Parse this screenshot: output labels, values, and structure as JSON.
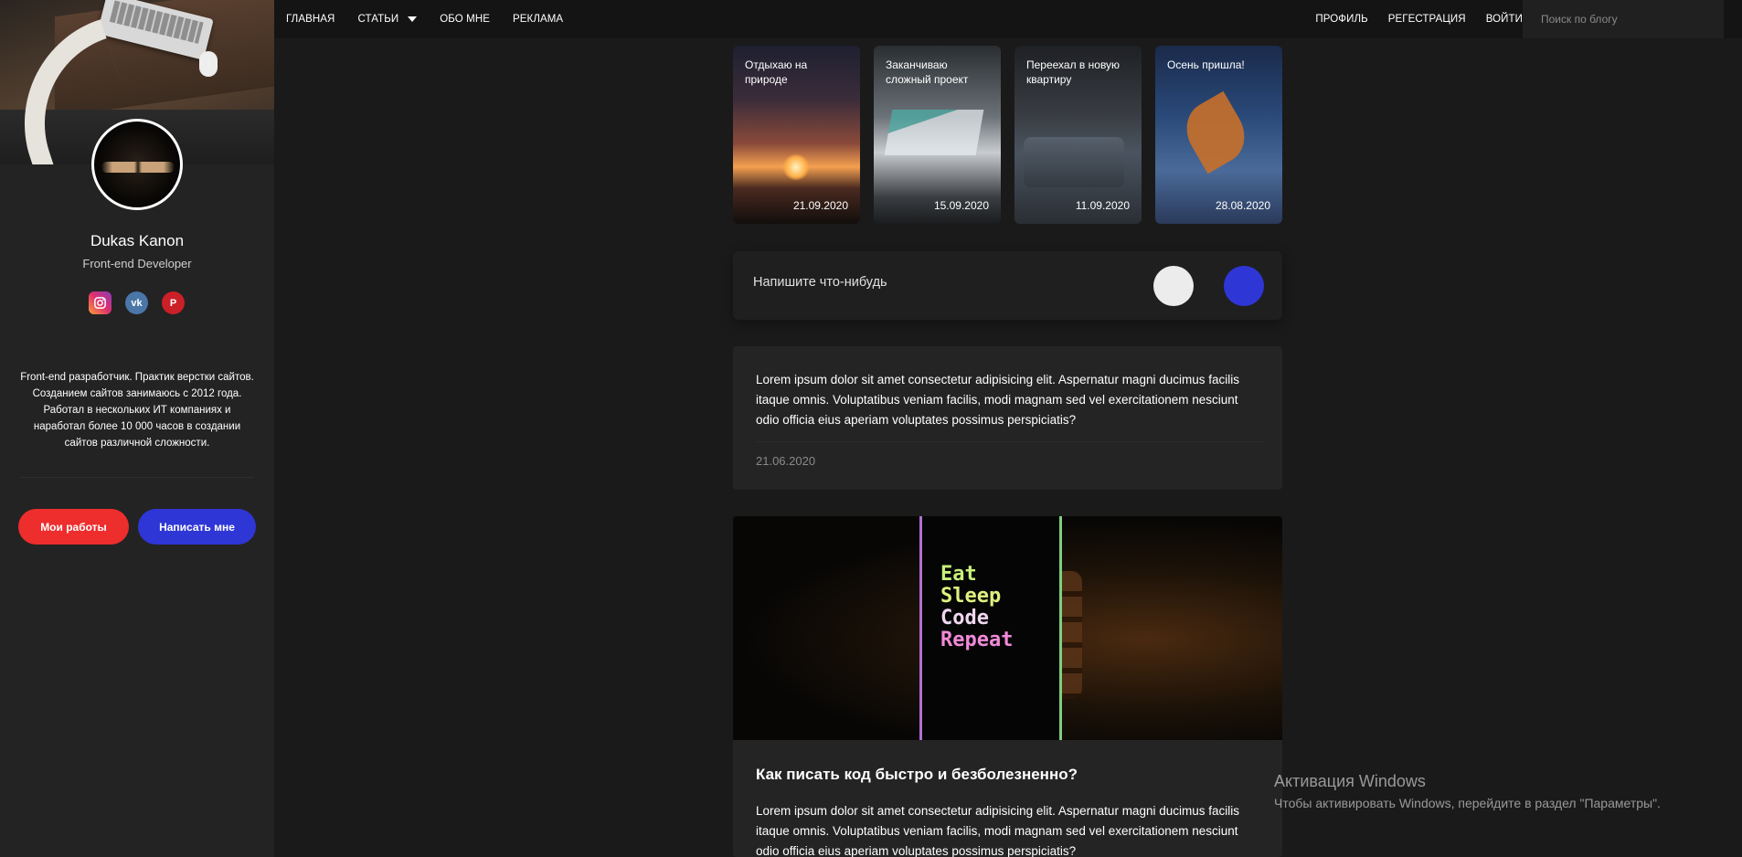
{
  "nav": {
    "left": [
      {
        "label": "ГЛАВНАЯ"
      },
      {
        "label": "СТАТЬИ"
      },
      {
        "label": "ОБО МНЕ"
      },
      {
        "label": "РЕКЛАМА"
      }
    ],
    "right": [
      {
        "label": "ПРОФИЛЬ"
      },
      {
        "label": "РЕГЕСТРАЦИЯ"
      },
      {
        "label": "ВОЙТИ"
      }
    ],
    "search_placeholder": "Поиск по блогу"
  },
  "profile": {
    "name": "Dukas Kanon",
    "role": "Front-end Developer",
    "socials": [
      "instagram-icon",
      "vk-icon",
      "pinterest-icon"
    ],
    "bio": "Front-end разработчик. Практик верстки сайтов. Созданием сайтов занимаюсь с 2012 года. Работал в нескольких ИТ компаниях и наработал более 10 000 часов в создании сайтов различной сложности.",
    "btn_works": "Мои работы",
    "btn_write": "Написать мне"
  },
  "stories": [
    {
      "title": "Отдыхаю на природе",
      "date": "21.09.2020"
    },
    {
      "title": "Заканчиваю сложный проект",
      "date": "15.09.2020"
    },
    {
      "title": "Переехал в новую квартиру",
      "date": "11.09.2020"
    },
    {
      "title": "Осень пришла!",
      "date": "28.08.2020"
    }
  ],
  "composer": {
    "placeholder": "Напишите что-нибудь"
  },
  "posts": [
    {
      "body": "Lorem ipsum dolor sit amet consectetur adipisicing elit. Aspernatur magni ducimus facilis itaque omnis. Voluptatibus veniam facilis, modi magnam sed vel exercitationem nesciunt odio officia eius aperiam voluptates possimus perspiciatis?",
      "date": "21.06.2020"
    },
    {
      "image_text": [
        "Eat",
        "Sleep",
        "Code",
        "Repeat"
      ],
      "title": "Как писать код быстро и безболезненно?",
      "body": "Lorem ipsum dolor sit amet consectetur adipisicing elit. Aspernatur magni ducimus facilis itaque omnis. Voluptatibus veniam facilis, modi magnam sed vel exercitationem nesciunt odio officia eius aperiam voluptates possimus perspiciatis?"
    }
  ],
  "watermark": {
    "title": "Активация Windows",
    "subtitle": "Чтобы активировать Windows, перейдите в раздел \"Параметры\"."
  },
  "colors": {
    "accent_red": "#ee2d2d",
    "accent_blue": "#2f36d6",
    "background": "#1a1a1a",
    "sidebar": "#232323"
  }
}
